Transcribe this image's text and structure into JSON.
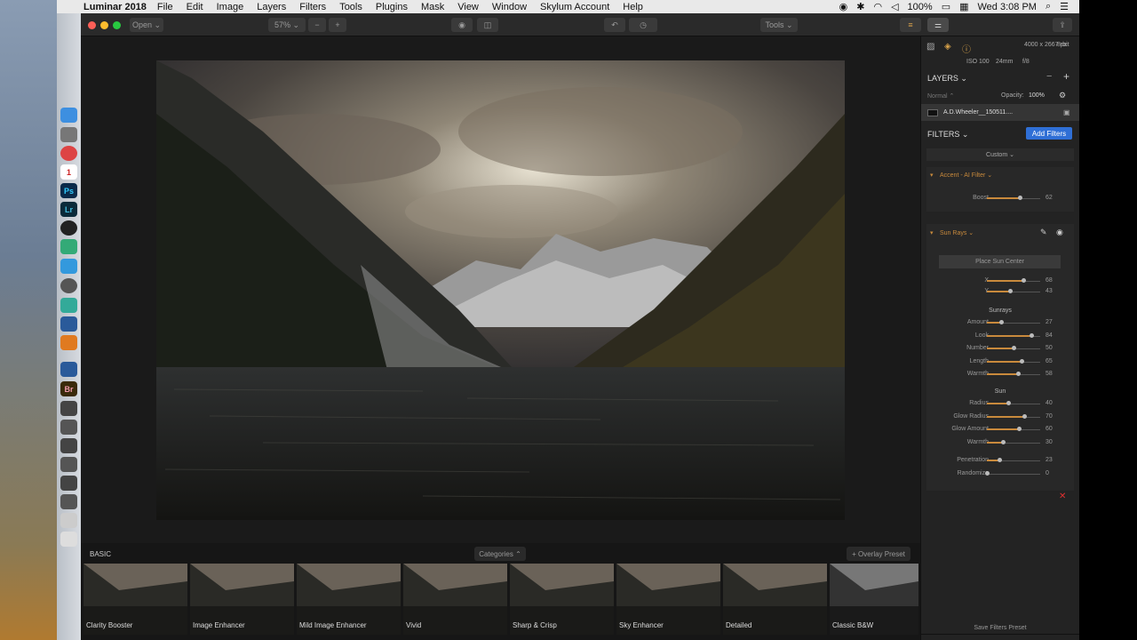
{
  "macbar": {
    "app": "Luminar 2018",
    "menus": [
      "File",
      "Edit",
      "Image",
      "Layers",
      "Filters",
      "Tools",
      "Plugins",
      "Mask",
      "View",
      "Window",
      "Skylum Account",
      "Help"
    ],
    "battery": "100%",
    "time": "Wed 3:08 PM"
  },
  "toolbar": {
    "open": "Open ⌄",
    "zoom": "57% ⌄",
    "minus": "−",
    "plus": "+",
    "tools": "Tools ⌄"
  },
  "info": {
    "dims": "4000 x 2667 px",
    "bit": "8-bit",
    "iso": "ISO 100",
    "focal": "24mm",
    "aperture": "f/8"
  },
  "layers": {
    "title": "LAYERS ⌄",
    "blend": "Normal ⌃",
    "opacity_label": "Opacity:",
    "opacity_value": "100%",
    "layer_name": "A.D.Wheeler__150511...."
  },
  "filters": {
    "title": "FILTERS ⌄",
    "add": "Add Filters",
    "preset": "Custom ⌄",
    "accent_title": "Accent - AI Filter ⌄",
    "boost_label": "Boost",
    "boost_value": 62,
    "sunrays_title": "Sun Rays ⌄",
    "place_sun": "Place Sun Center",
    "xy": [
      {
        "label": "X",
        "value": 68
      },
      {
        "label": "Y",
        "value": 43
      }
    ],
    "sunrays_section": "Sunrays",
    "sunrays": [
      {
        "label": "Amount",
        "value": 27
      },
      {
        "label": "Look",
        "value": 84
      },
      {
        "label": "Number",
        "value": 50
      },
      {
        "label": "Length",
        "value": 65
      },
      {
        "label": "Warmth",
        "value": 58
      }
    ],
    "sun_section": "Sun",
    "sun": [
      {
        "label": "Radius",
        "value": 40
      },
      {
        "label": "Glow Radius",
        "value": 70
      },
      {
        "label": "Glow Amount",
        "value": 60
      },
      {
        "label": "Warmth",
        "value": 30
      }
    ],
    "extra": [
      {
        "label": "Penetration",
        "value": 23
      },
      {
        "label": "Randomize",
        "value": 0
      }
    ],
    "save_preset": "Save Filters Preset"
  },
  "strip": {
    "section": "BASIC",
    "categories": "Categories ⌃",
    "overlay": "+ Overlay Preset",
    "presets": [
      "Clarity Booster",
      "Image Enhancer",
      "Mild Image Enhancer",
      "Vivid",
      "Sharp & Crisp",
      "Sky Enhancer",
      "Detailed",
      "Classic B&W"
    ]
  },
  "colors": {
    "accent": "#c98a3c",
    "button_blue": "#2f6fd6",
    "panel": "#232323"
  }
}
